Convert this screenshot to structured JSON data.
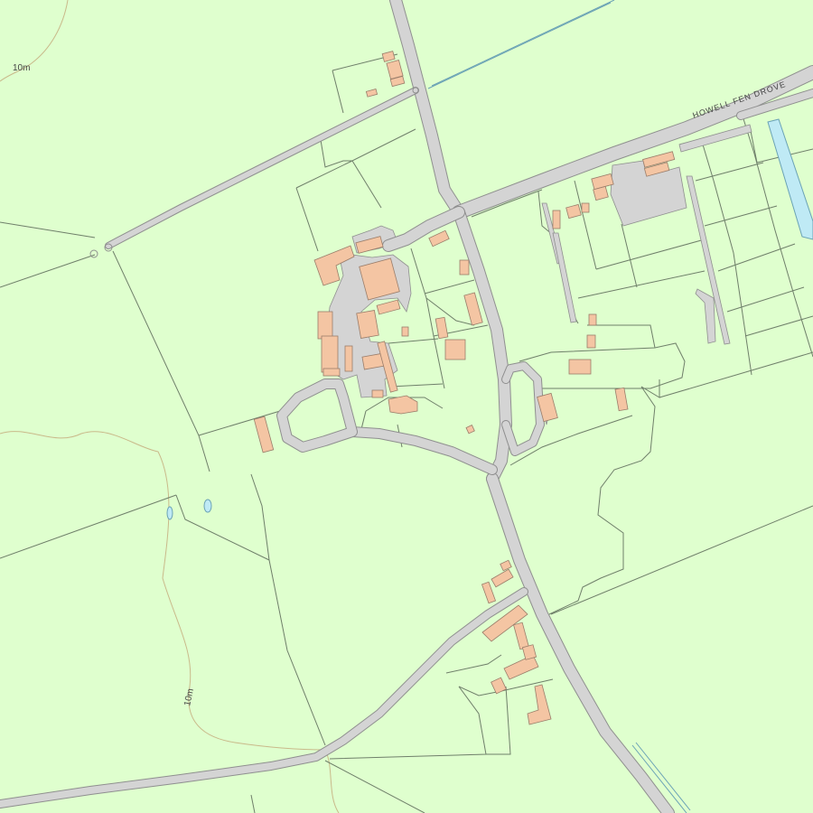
{
  "map": {
    "road_labels": {
      "howell_fen_drove": "HOWELL FEN DROVE"
    },
    "contour_labels": {
      "north": "10m",
      "south": "10m"
    },
    "colors": {
      "land": "#dfffce",
      "road": "#d4d4d4",
      "road_edge": "#8f8f8f",
      "building": "#f4c5a3",
      "water": "#bfeaf5",
      "field_boundary": "#6f7f6a",
      "contour": "#c9b98a"
    }
  }
}
